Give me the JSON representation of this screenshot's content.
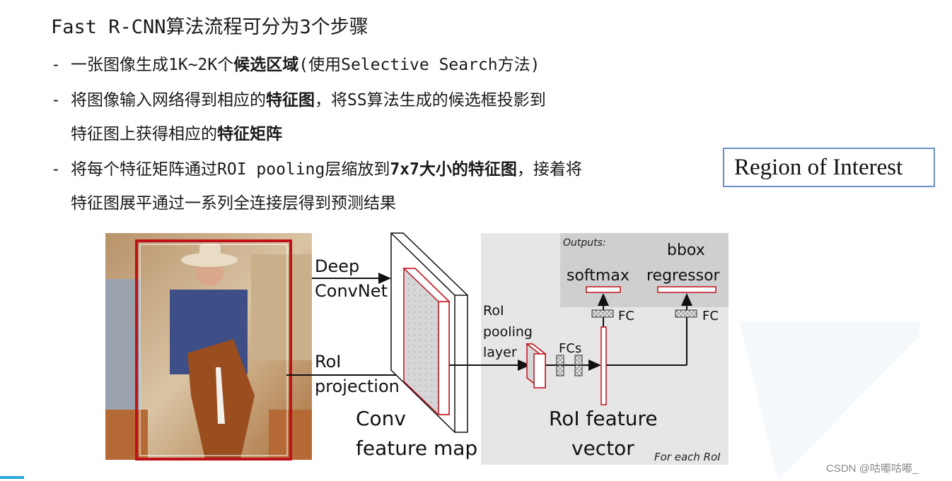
{
  "slide": {
    "title": "Fast R-CNN算法流程可分为3个步骤",
    "bullets": [
      {
        "dash": "-",
        "parts": [
          {
            "text": "一张图像生成1K~2K个",
            "bold": false
          },
          {
            "text": "候选区域",
            "bold": true
          },
          {
            "text": "(使用Selective Search方法)",
            "bold": false
          }
        ]
      },
      {
        "dash": "-",
        "parts": [
          {
            "text": "将图像输入网络得到相应的",
            "bold": false
          },
          {
            "text": "特征图",
            "bold": true
          },
          {
            "text": "，将SS算法生成的候选框投影到",
            "bold": false
          }
        ]
      },
      {
        "dash": "",
        "parts": [
          {
            "text": "特征图上获得相应的",
            "bold": false
          },
          {
            "text": "特征矩阵",
            "bold": true
          }
        ]
      },
      {
        "dash": "-",
        "parts": [
          {
            "text": "将每个特征矩阵通过ROI pooling层缩放到",
            "bold": false
          },
          {
            "text": "7x7大小的特征图",
            "bold": true
          },
          {
            "text": "，接着将",
            "bold": false
          }
        ]
      },
      {
        "dash": "",
        "parts": [
          {
            "text": "特征图展平通过一系列全连接层得到预测结果",
            "bold": false
          }
        ]
      }
    ],
    "callout": "Region of Interest"
  },
  "diagram": {
    "labels": {
      "deep_convnet_1": "Deep",
      "deep_convnet_2": "ConvNet",
      "roi_projection_1": "RoI",
      "roi_projection_2": "projection",
      "conv_feature_map_1": "Conv",
      "conv_feature_map_2": "feature map",
      "roi_pooling_1": "RoI",
      "roi_pooling_2": "pooling",
      "roi_pooling_3": "layer",
      "fcs": "FCs",
      "outputs": "Outputs:",
      "softmax": "softmax",
      "bbox_1": "bbox",
      "bbox_2": "regressor",
      "fc_left": "FC",
      "fc_right": "FC",
      "roi_feature_vector_1": "RoI feature",
      "roi_feature_vector_2": "vector",
      "for_each_roi": "For each RoI"
    },
    "colors": {
      "roi_red": "#c0101a",
      "panel_gray": "#e6e6e6",
      "outputs_gray": "#cfcfcf"
    }
  },
  "footer": {
    "watermark": "CSDN @咕嘟咕嘟_",
    "accent": "#29a8e0"
  }
}
